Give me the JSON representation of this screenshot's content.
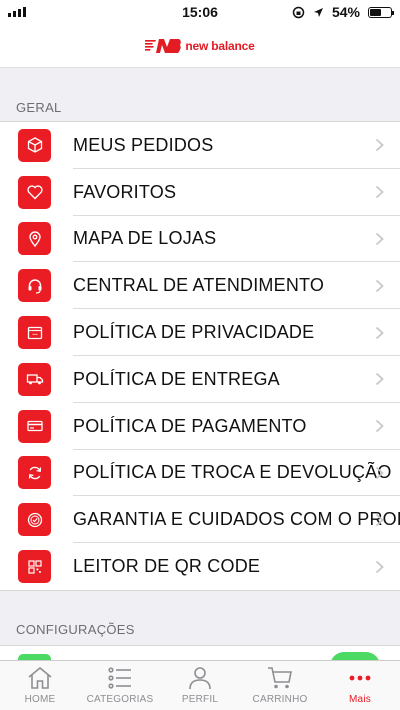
{
  "status_bar": {
    "time": "15:06",
    "battery": "54%",
    "battery_level": 0.54
  },
  "header": {
    "brand": "new balance"
  },
  "sections": {
    "geral": "GERAL",
    "configuracoes": "CONFIGURAÇÕES"
  },
  "menu": {
    "items": [
      {
        "label": "MEUS PEDIDOS",
        "icon": "box-icon"
      },
      {
        "label": "FAVORITOS",
        "icon": "heart-icon"
      },
      {
        "label": "MAPA DE LOJAS",
        "icon": "location-pin-icon"
      },
      {
        "label": "CENTRAL DE ATENDIMENTO",
        "icon": "headset-icon"
      },
      {
        "label": "POLÍTICA DE PRIVACIDADE",
        "icon": "privacy-icon"
      },
      {
        "label": "POLÍTICA DE ENTREGA",
        "icon": "truck-icon"
      },
      {
        "label": "POLÍTICA DE PAGAMENTO",
        "icon": "credit-card-icon"
      },
      {
        "label": "POLÍTICA DE TROCA E DEVOLUÇÃO",
        "icon": "refresh-icon"
      },
      {
        "label": "GARANTIA E CUIDADOS COM O PRODUTO",
        "icon": "warranty-badge-icon"
      },
      {
        "label": "LEITOR DE QR CODE",
        "icon": "qr-code-icon"
      }
    ]
  },
  "tabs": [
    {
      "label": "HOME",
      "icon": "home-icon",
      "active": false
    },
    {
      "label": "CATEGORIAS",
      "icon": "list-icon",
      "active": false
    },
    {
      "label": "PERFIL",
      "icon": "profile-icon",
      "active": false
    },
    {
      "label": "CARRINHO",
      "icon": "cart-icon",
      "active": false
    },
    {
      "label": "Mais",
      "icon": "more-icon",
      "active": true
    }
  ],
  "colors": {
    "accent": "#ea1d25",
    "toggle_on": "#4cd964",
    "background": "#efeff4"
  }
}
